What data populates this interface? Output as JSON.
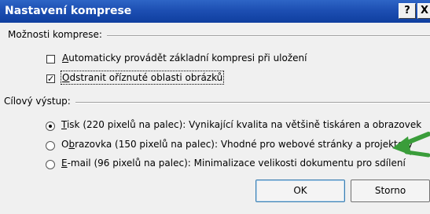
{
  "window": {
    "title": "Nastavení komprese",
    "help_glyph": "?",
    "close_glyph": "X"
  },
  "compression": {
    "label": "Možnosti komprese:",
    "options": [
      {
        "pre": "",
        "key": "A",
        "post": "utomaticky provádět základní kompresi při uložení",
        "checked": false,
        "mark": ""
      },
      {
        "pre": "",
        "key": "O",
        "post": "dstranit oříznuté oblasti obrázků",
        "checked": true,
        "mark": "✓"
      }
    ]
  },
  "output": {
    "label": "Cílový výstup:",
    "options": [
      {
        "pre": "",
        "key": "T",
        "post": "isk (220 pixelů na palec): Vynikající kvalita na většině tiskáren a obrazovek",
        "selected": true
      },
      {
        "pre": "O",
        "key": "b",
        "post": "razovka (150 pixelů na palec): Vhodné pro webové stránky a projektory",
        "selected": false
      },
      {
        "pre": "",
        "key": "E",
        "post": "-mail (96 pixelů na palec): Minimalizace velikosti dokumentu pro sdílení",
        "selected": false
      }
    ]
  },
  "buttons": {
    "ok": "OK",
    "cancel": "Storno"
  },
  "colors": {
    "titlebar": "#1d4fb3",
    "annotation_arrow": "#3a9d3a"
  },
  "icons": {
    "annotation": "green-arrow-icon"
  }
}
